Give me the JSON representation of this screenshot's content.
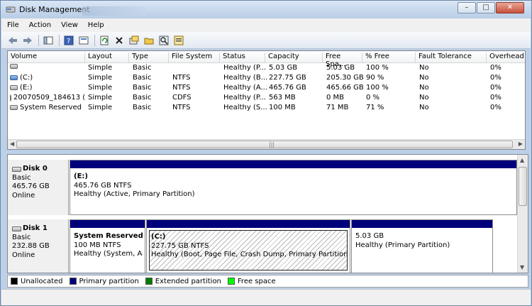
{
  "window": {
    "title": "Disk Management",
    "controls": {
      "minimize": "–",
      "maximize": "□",
      "close": "✕"
    }
  },
  "menu": [
    "File",
    "Action",
    "View",
    "Help"
  ],
  "toolbar": {
    "icons": [
      "back-icon",
      "forward-icon",
      "console-tree-icon",
      "help-icon",
      "properties-icon",
      "refresh-icon",
      "delete-icon",
      "settings-icon",
      "open-icon",
      "search-icon",
      "export-icon"
    ]
  },
  "volume_list": {
    "columns": [
      "Volume",
      "Layout",
      "Type",
      "File System",
      "Status",
      "Capacity",
      "Free Spa...",
      "% Free",
      "Fault Tolerance",
      "Overhead"
    ],
    "rows": [
      {
        "icon": "drive",
        "volume": "",
        "layout": "Simple",
        "type": "Basic",
        "fs": "",
        "status": "Healthy (P...",
        "capacity": "5.03 GB",
        "free": "5.03 GB",
        "pct": "100 %",
        "fault": "No",
        "overhead": "0%"
      },
      {
        "icon": "system-drive",
        "volume": "(C:)",
        "layout": "Simple",
        "type": "Basic",
        "fs": "NTFS",
        "status": "Healthy (B...",
        "capacity": "227.75 GB",
        "free": "205.30 GB",
        "pct": "90 %",
        "fault": "No",
        "overhead": "0%"
      },
      {
        "icon": "drive",
        "volume": "(E:)",
        "layout": "Simple",
        "type": "Basic",
        "fs": "NTFS",
        "status": "Healthy (A...",
        "capacity": "465.76 GB",
        "free": "465.66 GB",
        "pct": "100 %",
        "fault": "No",
        "overhead": "0%"
      },
      {
        "icon": "cd",
        "volume": "20070509_184613 (...",
        "layout": "Simple",
        "type": "Basic",
        "fs": "CDFS",
        "status": "Healthy (P...",
        "capacity": "563 MB",
        "free": "0 MB",
        "pct": "0 %",
        "fault": "No",
        "overhead": "0%"
      },
      {
        "icon": "drive",
        "volume": "System Reserved",
        "layout": "Simple",
        "type": "Basic",
        "fs": "NTFS",
        "status": "Healthy (S...",
        "capacity": "100 MB",
        "free": "71 MB",
        "pct": "71 %",
        "fault": "No",
        "overhead": "0%"
      }
    ]
  },
  "disks": [
    {
      "name": "Disk 0",
      "kind": "Basic",
      "size": "465.76 GB",
      "state": "Online",
      "partitions": [
        {
          "name": "(E:)",
          "size": "465.76 GB NTFS",
          "status": "Healthy (Active, Primary Partition)",
          "hatched": false
        }
      ]
    },
    {
      "name": "Disk 1",
      "kind": "Basic",
      "size": "232.88 GB",
      "state": "Online",
      "partitions": [
        {
          "name": "System Reserved",
          "size": "100 MB NTFS",
          "status": "Healthy (System, Acti",
          "hatched": false
        },
        {
          "name": "(C:)",
          "size": "227.75 GB NTFS",
          "status": "Healthy (Boot, Page File, Crash Dump, Primary Partition)",
          "hatched": true
        },
        {
          "name": "",
          "size": "5.03 GB",
          "status": "Healthy (Primary Partition)",
          "hatched": false
        }
      ]
    }
  ],
  "legend": [
    {
      "label": "Unallocated",
      "color": "#000000"
    },
    {
      "label": "Primary partition",
      "color": "#00007b"
    },
    {
      "label": "Extended partition",
      "color": "#007b00"
    },
    {
      "label": "Free space",
      "color": "#00ff00"
    }
  ]
}
